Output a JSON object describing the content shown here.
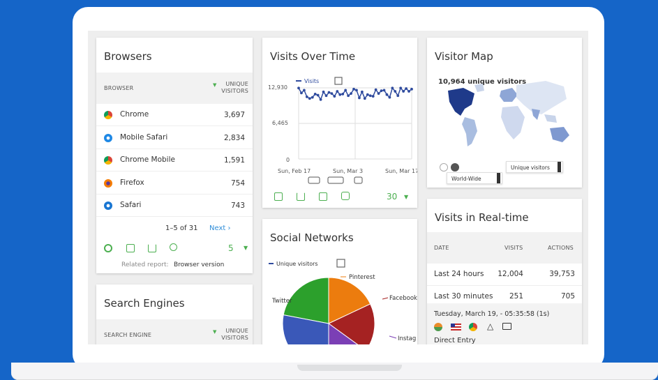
{
  "browsers": {
    "title": "Browsers",
    "col_browser": "BROWSER",
    "col_unique": "UNIQUE VISITORS",
    "rows": [
      {
        "name": "Chrome",
        "value": "3,697"
      },
      {
        "name": "Mobile Safari",
        "value": "2,834"
      },
      {
        "name": "Chrome Mobile",
        "value": "1,591"
      },
      {
        "name": "Firefox",
        "value": "754"
      },
      {
        "name": "Safari",
        "value": "743"
      }
    ],
    "pagination": "1–5 of 31",
    "next": "Next ›",
    "limit": "5",
    "related_prefix": "Related report:",
    "related_link": "Browser version"
  },
  "search_engines": {
    "title": "Search Engines",
    "col_engine": "SEARCH ENGINE",
    "col_unique": "UNIQUE VISITORS"
  },
  "visits_over_time": {
    "title": "Visits Over Time",
    "legend": "Visits",
    "y_ticks": [
      "12,930",
      "6,465",
      "0"
    ],
    "x_ticks": [
      "Sun, Feb 17",
      "Sun, Mar 3",
      "Sun, Mar 17"
    ],
    "limit": "30"
  },
  "chart_data": [
    {
      "type": "line",
      "title": "Visits Over Time",
      "xlabel": "",
      "ylabel": "",
      "x_ticks": [
        "Sun, Feb 17",
        "Sun, Mar 3",
        "Sun, Mar 17"
      ],
      "ylim": [
        0,
        12930
      ],
      "grid": true,
      "series": [
        {
          "name": "Visits",
          "values": [
            12900,
            12000,
            12500,
            11300,
            11000,
            11200,
            11800,
            11600,
            10800,
            12200,
            11500,
            12100,
            11900,
            11400,
            12300,
            11700,
            11800,
            12500,
            11500,
            11900,
            12700,
            12500,
            11100,
            12200,
            11000,
            11700,
            11500,
            11400,
            12600,
            11900,
            12400,
            12500,
            11700,
            11200,
            12900,
            12300,
            11500,
            12900,
            12300,
            12800,
            12300,
            12700
          ]
        }
      ]
    },
    {
      "type": "pie",
      "title": "Social Networks",
      "legend": "Unique visitors",
      "slices": [
        {
          "label": "Twitter",
          "value": 22
        },
        {
          "label": "Pinterest",
          "value": 18
        },
        {
          "label": "Facebook",
          "value": 17
        },
        {
          "label": "Instagram",
          "value": 15
        },
        {
          "label": "",
          "value": 28
        }
      ],
      "colors": [
        "#2ca02c",
        "#ec7c0e",
        "#a52222",
        "#7b3fb5",
        "#3a58b8"
      ]
    }
  ],
  "social": {
    "title": "Social Networks",
    "legend": "Unique visitors",
    "labels": [
      "Pinterest",
      "Twitter",
      "Facebook",
      "Instag"
    ]
  },
  "visitor_map": {
    "title": "Visitor Map",
    "summary": "10,964 unique visitors",
    "region_select": "World-Wide",
    "metric_select": "Unique visitors"
  },
  "realtime": {
    "title": "Visits in Real-time",
    "col_date": "DATE",
    "col_visits": "VISITS",
    "col_actions": "ACTIONS",
    "rows": [
      {
        "label": "Last 24 hours",
        "visits": "12,004",
        "actions": "39,753"
      },
      {
        "label": "Last 30 minutes",
        "visits": "251",
        "actions": "705"
      }
    ],
    "visit_time": "Tuesday, March 19, - 05:35:58 (1s)",
    "referrer": "Direct Entry"
  },
  "colors": {
    "background": "#1565c8",
    "accent_green": "#4caf50",
    "link_blue": "#2d8cd8",
    "line_series": "#2f4b9e"
  }
}
